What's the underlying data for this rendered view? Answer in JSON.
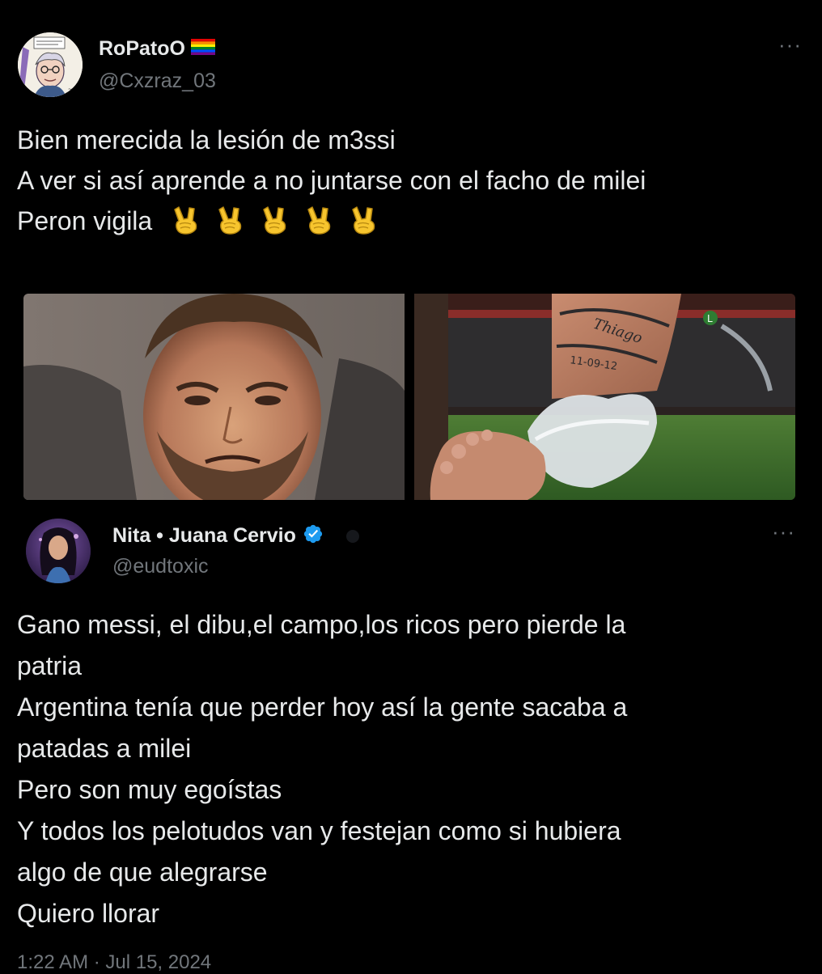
{
  "main_tweet": {
    "author": {
      "display_name": "RoPatoO",
      "handle": "@Cxzraz_03",
      "flag_icon": "rainbow-flag-icon"
    },
    "more_label": "···",
    "text_lines": [
      "Bien merecida la lesión de m3ssi",
      "A ver si así aprende a no juntarse con el facho de milei",
      "Peron vigila"
    ],
    "emoji_count": 5,
    "emoji_icon": "victory-hand-icon"
  },
  "quoted_tweet": {
    "author": {
      "display_name": "Nita • Juana Cervio",
      "handle": "@eudtoxic",
      "verified": true
    },
    "more_label": "···",
    "text_lines": [
      "Gano messi, el dibu,el campo,los ricos pero pierde la",
      "patria",
      "Argentina tenía que perder hoy así la gente sacaba a",
      "patadas a milei",
      "Pero son muy egoístas",
      "Y todos los pelotudos van y festejan como si hubiera",
      "algo de que alegrarse",
      "Quiero llorar"
    ]
  },
  "media": [
    {
      "name": "crying-player-photo"
    },
    {
      "name": "injured-ankle-photo"
    }
  ],
  "timestamp": "1:22 AM · Jul 15, 2024",
  "colors": {
    "background": "#000000",
    "text": "#e7e9ea",
    "secondary": "#71767b",
    "verified": "#1d9bf0"
  }
}
